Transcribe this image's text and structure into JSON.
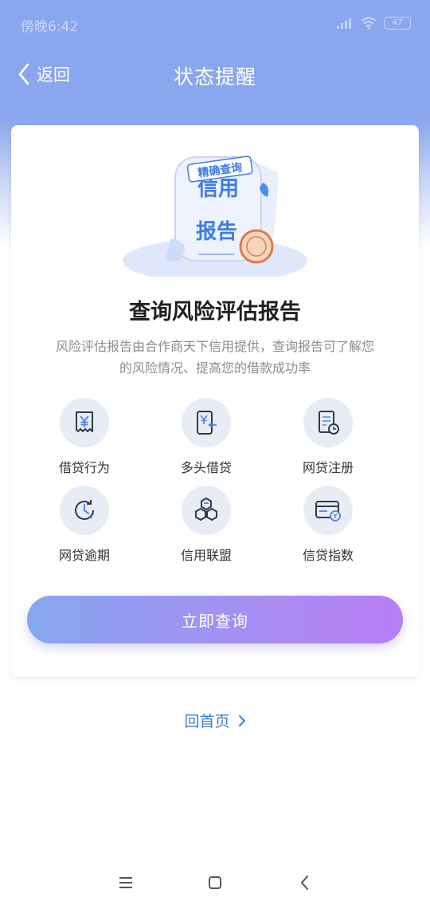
{
  "status_bar": {
    "time": "傍晚6:42",
    "battery": "47"
  },
  "nav": {
    "back_label": "返回",
    "title": "状态提醒"
  },
  "hero": {
    "tag_text": "精确查询",
    "line1": "信用",
    "line2": "报告"
  },
  "report": {
    "title": "查询风险评估报告",
    "description": "风险评估报告由合作商天下信用提供，查询报告可了解您的风险情况、提高您的借款成功率"
  },
  "features": [
    {
      "label": "借贷行为",
      "icon": "receipt-yen-icon"
    },
    {
      "label": "多头借贷",
      "icon": "phone-yen-icon"
    },
    {
      "label": "网贷注册",
      "icon": "document-clock-icon"
    },
    {
      "label": "网贷逾期",
      "icon": "overdue-clock-icon"
    },
    {
      "label": "信用联盟",
      "icon": "hexagons-icon"
    },
    {
      "label": "信贷指数",
      "icon": "card-coin-icon"
    }
  ],
  "actions": {
    "query_button": "立即查询",
    "home_link": "回首页"
  },
  "colors": {
    "header_blue": "#8aa6ee",
    "button_start": "#86a7f0",
    "button_end": "#b87df5",
    "link_blue": "#3a7fd8"
  }
}
